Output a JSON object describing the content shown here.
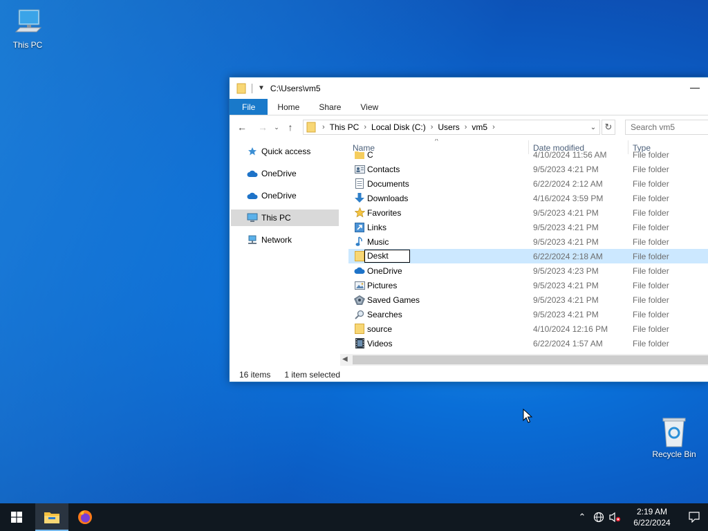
{
  "desktop": {
    "this_pc_label": "This PC",
    "recycle_bin_label": "Recycle Bin"
  },
  "window": {
    "title": "C:\\Users\\vm5",
    "tabs": [
      "File",
      "Home",
      "Share",
      "View"
    ],
    "breadcrumb": [
      "This PC",
      "Local Disk (C:)",
      "Users",
      "vm5"
    ],
    "search_placeholder": "Search vm5",
    "nav_pane": [
      {
        "label": "Quick access",
        "icon": "star-icon"
      },
      {
        "label": "OneDrive",
        "icon": "cloud-icon"
      },
      {
        "label": "OneDrive",
        "icon": "cloud-icon"
      },
      {
        "label": "This PC",
        "icon": "computer-icon",
        "selected": true
      },
      {
        "label": "Network",
        "icon": "network-icon"
      }
    ],
    "columns": {
      "name": "Name",
      "date": "Date modified",
      "type": "Type"
    },
    "rows": [
      {
        "name": "C",
        "date": "4/10/2024 11:56 AM",
        "type": "File folder",
        "icon": "folder-icon"
      },
      {
        "name": "Contacts",
        "date": "9/5/2023 4:21 PM",
        "type": "File folder",
        "icon": "contacts-icon"
      },
      {
        "name": "Documents",
        "date": "6/22/2024 2:12 AM",
        "type": "File folder",
        "icon": "documents-icon"
      },
      {
        "name": "Downloads",
        "date": "4/16/2024 3:59 PM",
        "type": "File folder",
        "icon": "downloads-icon"
      },
      {
        "name": "Favorites",
        "date": "9/5/2023 4:21 PM",
        "type": "File folder",
        "icon": "star-icon"
      },
      {
        "name": "Links",
        "date": "9/5/2023 4:21 PM",
        "type": "File folder",
        "icon": "links-icon"
      },
      {
        "name": "Music",
        "date": "9/5/2023 4:21 PM",
        "type": "File folder",
        "icon": "music-icon"
      },
      {
        "name": "Deskt",
        "date": "6/22/2024 2:18 AM",
        "type": "File folder",
        "icon": "folder-icon",
        "selected": true,
        "renaming": true
      },
      {
        "name": "OneDrive",
        "date": "9/5/2023 4:23 PM",
        "type": "File folder",
        "icon": "cloud-icon"
      },
      {
        "name": "Pictures",
        "date": "9/5/2023 4:21 PM",
        "type": "File folder",
        "icon": "pictures-icon"
      },
      {
        "name": "Saved Games",
        "date": "9/5/2023 4:21 PM",
        "type": "File folder",
        "icon": "saved-games-icon"
      },
      {
        "name": "Searches",
        "date": "9/5/2023 4:21 PM",
        "type": "File folder",
        "icon": "search-icon"
      },
      {
        "name": "source",
        "date": "4/10/2024 12:16 PM",
        "type": "File folder",
        "icon": "folder-icon"
      },
      {
        "name": "Videos",
        "date": "6/22/2024 1:57 AM",
        "type": "File folder",
        "icon": "videos-icon"
      }
    ],
    "status": {
      "items": "16 items",
      "selected": "1 item selected"
    }
  },
  "taskbar": {
    "time": "2:19 AM",
    "date": "6/22/2024"
  },
  "colors": {
    "accent": "#1979ca",
    "selection": "#cce8ff",
    "taskbar": "#101820"
  }
}
